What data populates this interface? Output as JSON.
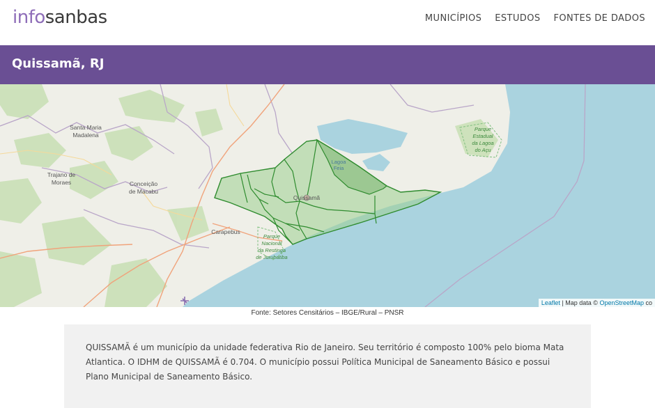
{
  "header": {
    "logo_part1": "info",
    "logo_part2": "sanbas",
    "nav": [
      "MUNICÍPIOS",
      "ESTUDOS",
      "FONTES DE DADOS"
    ]
  },
  "page_title": "Quissamã, RJ",
  "map": {
    "labels": {
      "santa_maria_1": "Santa Maria",
      "santa_maria_2": "Madalena",
      "trajano_1": "Trajano de",
      "trajano_2": "Moraes",
      "conceicao_1": "Conceição",
      "conceicao_2": "de Macabu",
      "carapebus": "Carapebus",
      "quissama": "Quissamã",
      "lagoa_feia_1": "Lagoa",
      "lagoa_feia_2": "Feia",
      "parque_acu_1": "Parque",
      "parque_acu_2": "Estadual",
      "parque_acu_3": "da Lagoa",
      "parque_acu_4": "do Açu",
      "parque_jur_1": "Parque",
      "parque_jur_2": "Nacional",
      "parque_jur_3": "da Restinga",
      "parque_jur_4": "de Jurubatiba"
    },
    "attribution": {
      "leaflet": "Leaflet",
      "sep": " | Map data © ",
      "osm": "OpenStreetMap",
      "tail": " co"
    }
  },
  "caption": "Fonte: Setores Censitários – IBGE/Rural – PNSR",
  "description": "QUISSAMÃ é um município da unidade federativa Rio de Janeiro. Seu território é composto 100% pelo bioma Mata Atlantica. O IDHM de QUISSAMÃ é 0.704. O município possui Política Municipal de Saneamento Básico e possui Plano Municipal de Saneamento Básico.",
  "colors": {
    "header_purple": "#6a4f94",
    "logo_purple": "#8e6db8",
    "sea": "#aad3df",
    "polygon_stroke": "#2e8b2e",
    "polygon_fill": "#9dcf8f"
  }
}
